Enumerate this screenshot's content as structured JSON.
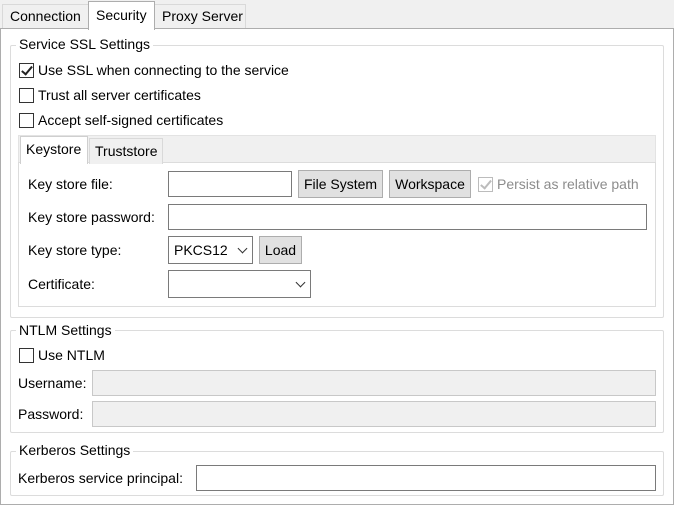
{
  "tabs": [
    {
      "label": "Connection",
      "active": false
    },
    {
      "label": "Security",
      "active": true
    },
    {
      "label": "Proxy Server",
      "active": false
    }
  ],
  "ssl": {
    "legend": "Service SSL Settings",
    "use_ssl": {
      "label": "Use SSL when connecting to the service",
      "checked": true
    },
    "trust_all": {
      "label": "Trust all server certificates",
      "checked": false
    },
    "accept_self_signed": {
      "label": "Accept self-signed certificates",
      "checked": false
    },
    "store_tabs": [
      {
        "label": "Keystore",
        "active": true
      },
      {
        "label": "Truststore",
        "active": false
      }
    ],
    "key_store_file": {
      "label": "Key store file:",
      "value": ""
    },
    "file_system_button": "File System",
    "workspace_button": "Workspace",
    "persist_relative": {
      "label": "Persist as relative path",
      "checked": true,
      "enabled": false
    },
    "key_store_password": {
      "label": "Key store password:",
      "value": ""
    },
    "key_store_type": {
      "label": "Key store type:",
      "value": "PKCS12"
    },
    "load_button": "Load",
    "certificate": {
      "label": "Certificate:",
      "value": ""
    }
  },
  "ntlm": {
    "legend": "NTLM Settings",
    "use_ntlm": {
      "label": "Use NTLM",
      "checked": false
    },
    "username": {
      "label": "Username:",
      "value": ""
    },
    "password": {
      "label": "Password:",
      "value": ""
    }
  },
  "kerberos": {
    "legend": "Kerberos Settings",
    "principal": {
      "label": "Kerberos service principal:",
      "value": ""
    }
  }
}
